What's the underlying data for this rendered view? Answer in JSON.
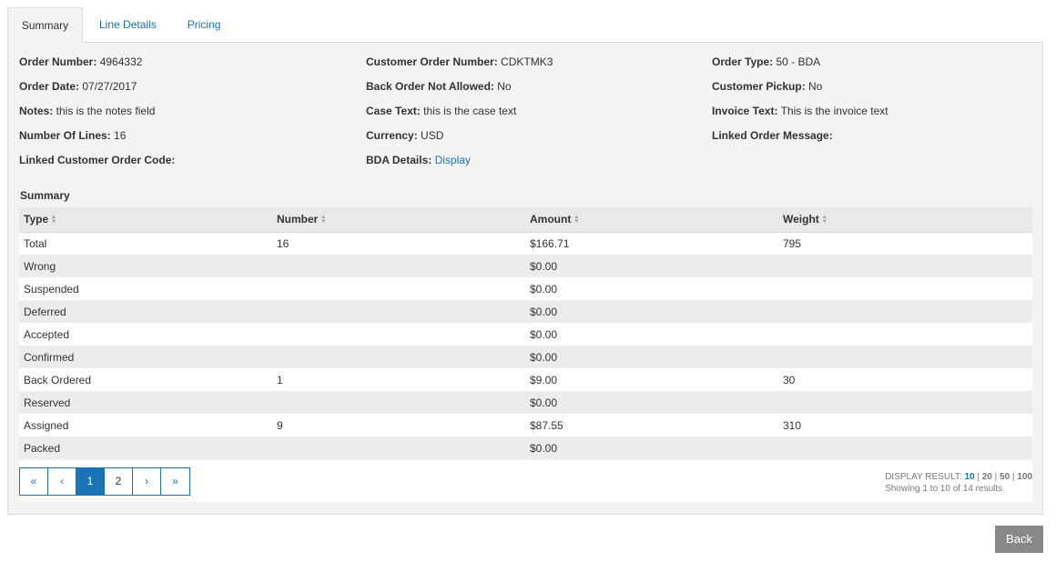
{
  "tabs": [
    "Summary",
    "Line Details",
    "Pricing"
  ],
  "info": [
    [
      {
        "label": "Order Number:",
        "value": " 4964332"
      },
      {
        "label": "Customer Order Number:",
        "value": " CDKTMK3"
      },
      {
        "label": "Order Type:",
        "value": " 50 - BDA"
      }
    ],
    [
      {
        "label": "Order Date:",
        "value": " 07/27/2017"
      },
      {
        "label": "Back Order Not Allowed:",
        "value": " No"
      },
      {
        "label": "Customer Pickup:",
        "value": " No"
      }
    ],
    [
      {
        "label": "Notes:",
        "value": " this is the notes field"
      },
      {
        "label": "Case Text:",
        "value": " this is the case text"
      },
      {
        "label": "Invoice Text:",
        "value": " This is the invoice text"
      }
    ],
    [
      {
        "label": "Number Of Lines:",
        "value": " 16"
      },
      {
        "label": "Currency:",
        "value": " USD"
      },
      {
        "label": "Linked Order Message:",
        "value": ""
      }
    ],
    [
      {
        "label": "Linked Customer Order Code:",
        "value": ""
      },
      {
        "label": "BDA Details:",
        "value": " ",
        "link": "Display"
      },
      null
    ]
  ],
  "summary": {
    "title": "Summary",
    "columns": [
      "Type",
      "Number",
      "Amount",
      "Weight"
    ],
    "rows": [
      [
        "Total",
        "16",
        "$166.71",
        "795"
      ],
      [
        "Wrong",
        "",
        "$0.00",
        ""
      ],
      [
        "Suspended",
        "",
        "$0.00",
        ""
      ],
      [
        "Deferred",
        "",
        "$0.00",
        ""
      ],
      [
        "Accepted",
        "",
        "$0.00",
        ""
      ],
      [
        "Confirmed",
        "",
        "$0.00",
        ""
      ],
      [
        "Back Ordered",
        "1",
        "$9.00",
        "30"
      ],
      [
        "Reserved",
        "",
        "$0.00",
        ""
      ],
      [
        "Assigned",
        "9",
        "$87.55",
        "310"
      ],
      [
        "Packed",
        "",
        "$0.00",
        ""
      ]
    ]
  },
  "pager": {
    "first": "«",
    "prev": "‹",
    "pages": [
      "1",
      "2"
    ],
    "current": "1",
    "next": "›",
    "last": "»"
  },
  "display": {
    "label": "DISPLAY RESULT:",
    "sizes": [
      "10",
      "20",
      "50",
      "100"
    ],
    "selected": "10",
    "showing": "Showing 1 to 10 of 14 results"
  },
  "back_label": "Back",
  "colors": {
    "accent": "#1a73b5",
    "panel": "#f3f3f3",
    "button": "#888888"
  }
}
